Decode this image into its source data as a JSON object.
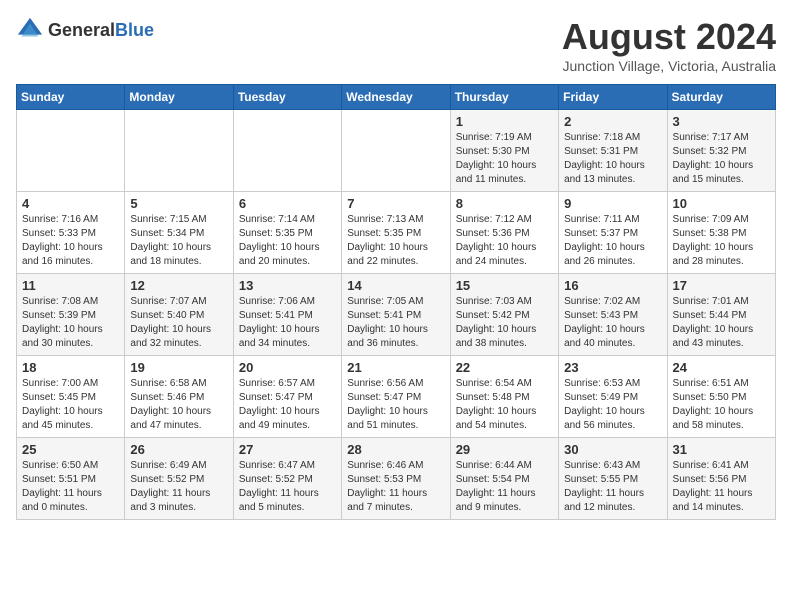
{
  "header": {
    "logo_general": "General",
    "logo_blue": "Blue",
    "month_year": "August 2024",
    "location": "Junction Village, Victoria, Australia"
  },
  "weekdays": [
    "Sunday",
    "Monday",
    "Tuesday",
    "Wednesday",
    "Thursday",
    "Friday",
    "Saturday"
  ],
  "weeks": [
    [
      {
        "day": "",
        "info": ""
      },
      {
        "day": "",
        "info": ""
      },
      {
        "day": "",
        "info": ""
      },
      {
        "day": "",
        "info": ""
      },
      {
        "day": "1",
        "info": "Sunrise: 7:19 AM\nSunset: 5:30 PM\nDaylight: 10 hours\nand 11 minutes."
      },
      {
        "day": "2",
        "info": "Sunrise: 7:18 AM\nSunset: 5:31 PM\nDaylight: 10 hours\nand 13 minutes."
      },
      {
        "day": "3",
        "info": "Sunrise: 7:17 AM\nSunset: 5:32 PM\nDaylight: 10 hours\nand 15 minutes."
      }
    ],
    [
      {
        "day": "4",
        "info": "Sunrise: 7:16 AM\nSunset: 5:33 PM\nDaylight: 10 hours\nand 16 minutes."
      },
      {
        "day": "5",
        "info": "Sunrise: 7:15 AM\nSunset: 5:34 PM\nDaylight: 10 hours\nand 18 minutes."
      },
      {
        "day": "6",
        "info": "Sunrise: 7:14 AM\nSunset: 5:35 PM\nDaylight: 10 hours\nand 20 minutes."
      },
      {
        "day": "7",
        "info": "Sunrise: 7:13 AM\nSunset: 5:35 PM\nDaylight: 10 hours\nand 22 minutes."
      },
      {
        "day": "8",
        "info": "Sunrise: 7:12 AM\nSunset: 5:36 PM\nDaylight: 10 hours\nand 24 minutes."
      },
      {
        "day": "9",
        "info": "Sunrise: 7:11 AM\nSunset: 5:37 PM\nDaylight: 10 hours\nand 26 minutes."
      },
      {
        "day": "10",
        "info": "Sunrise: 7:09 AM\nSunset: 5:38 PM\nDaylight: 10 hours\nand 28 minutes."
      }
    ],
    [
      {
        "day": "11",
        "info": "Sunrise: 7:08 AM\nSunset: 5:39 PM\nDaylight: 10 hours\nand 30 minutes."
      },
      {
        "day": "12",
        "info": "Sunrise: 7:07 AM\nSunset: 5:40 PM\nDaylight: 10 hours\nand 32 minutes."
      },
      {
        "day": "13",
        "info": "Sunrise: 7:06 AM\nSunset: 5:41 PM\nDaylight: 10 hours\nand 34 minutes."
      },
      {
        "day": "14",
        "info": "Sunrise: 7:05 AM\nSunset: 5:41 PM\nDaylight: 10 hours\nand 36 minutes."
      },
      {
        "day": "15",
        "info": "Sunrise: 7:03 AM\nSunset: 5:42 PM\nDaylight: 10 hours\nand 38 minutes."
      },
      {
        "day": "16",
        "info": "Sunrise: 7:02 AM\nSunset: 5:43 PM\nDaylight: 10 hours\nand 40 minutes."
      },
      {
        "day": "17",
        "info": "Sunrise: 7:01 AM\nSunset: 5:44 PM\nDaylight: 10 hours\nand 43 minutes."
      }
    ],
    [
      {
        "day": "18",
        "info": "Sunrise: 7:00 AM\nSunset: 5:45 PM\nDaylight: 10 hours\nand 45 minutes."
      },
      {
        "day": "19",
        "info": "Sunrise: 6:58 AM\nSunset: 5:46 PM\nDaylight: 10 hours\nand 47 minutes."
      },
      {
        "day": "20",
        "info": "Sunrise: 6:57 AM\nSunset: 5:47 PM\nDaylight: 10 hours\nand 49 minutes."
      },
      {
        "day": "21",
        "info": "Sunrise: 6:56 AM\nSunset: 5:47 PM\nDaylight: 10 hours\nand 51 minutes."
      },
      {
        "day": "22",
        "info": "Sunrise: 6:54 AM\nSunset: 5:48 PM\nDaylight: 10 hours\nand 54 minutes."
      },
      {
        "day": "23",
        "info": "Sunrise: 6:53 AM\nSunset: 5:49 PM\nDaylight: 10 hours\nand 56 minutes."
      },
      {
        "day": "24",
        "info": "Sunrise: 6:51 AM\nSunset: 5:50 PM\nDaylight: 10 hours\nand 58 minutes."
      }
    ],
    [
      {
        "day": "25",
        "info": "Sunrise: 6:50 AM\nSunset: 5:51 PM\nDaylight: 11 hours\nand 0 minutes."
      },
      {
        "day": "26",
        "info": "Sunrise: 6:49 AM\nSunset: 5:52 PM\nDaylight: 11 hours\nand 3 minutes."
      },
      {
        "day": "27",
        "info": "Sunrise: 6:47 AM\nSunset: 5:52 PM\nDaylight: 11 hours\nand 5 minutes."
      },
      {
        "day": "28",
        "info": "Sunrise: 6:46 AM\nSunset: 5:53 PM\nDaylight: 11 hours\nand 7 minutes."
      },
      {
        "day": "29",
        "info": "Sunrise: 6:44 AM\nSunset: 5:54 PM\nDaylight: 11 hours\nand 9 minutes."
      },
      {
        "day": "30",
        "info": "Sunrise: 6:43 AM\nSunset: 5:55 PM\nDaylight: 11 hours\nand 12 minutes."
      },
      {
        "day": "31",
        "info": "Sunrise: 6:41 AM\nSunset: 5:56 PM\nDaylight: 11 hours\nand 14 minutes."
      }
    ]
  ]
}
